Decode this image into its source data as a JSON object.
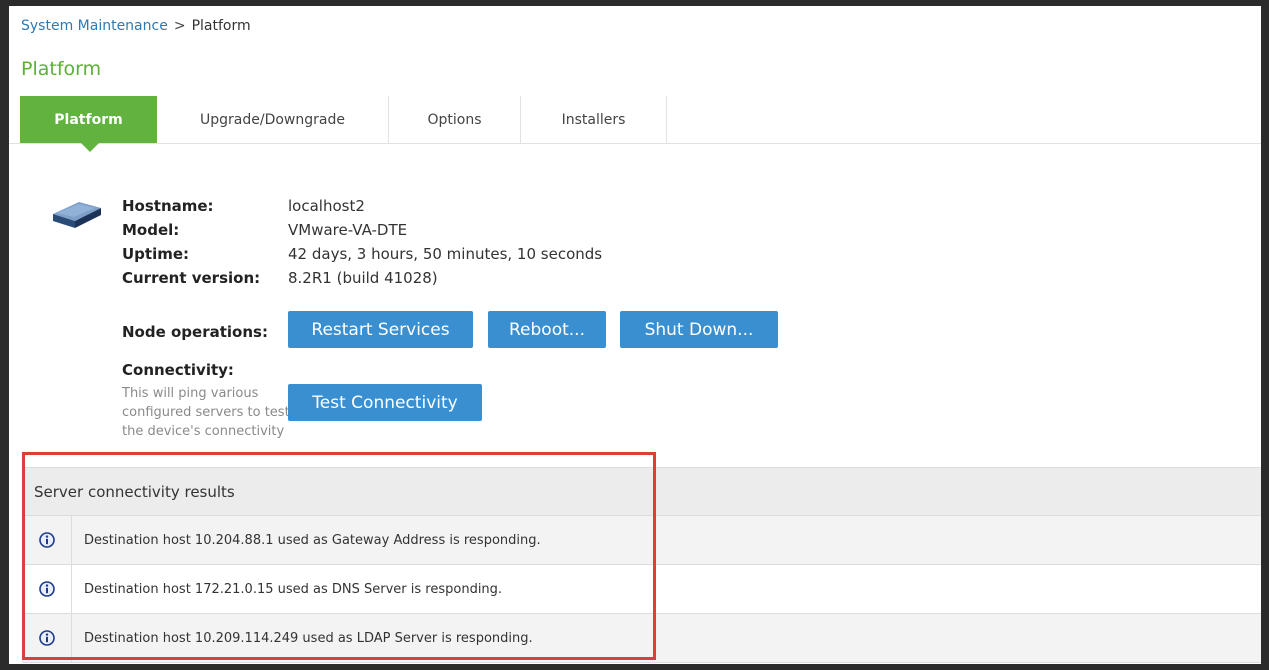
{
  "breadcrumb": {
    "parent": "System Maintenance",
    "separator": ">",
    "current": "Platform"
  },
  "page_title": "Platform",
  "tabs": [
    {
      "label": "Platform",
      "active": true
    },
    {
      "label": "Upgrade/Downgrade",
      "active": false
    },
    {
      "label": "Options",
      "active": false
    },
    {
      "label": "Installers",
      "active": false
    }
  ],
  "device": {
    "icon": "device-icon",
    "hostname_label": "Hostname:",
    "hostname": "localhost2",
    "model_label": "Model:",
    "model": "VMware-VA-DTE",
    "uptime_label": "Uptime:",
    "uptime": "42 days, 3 hours, 50 minutes, 10 seconds",
    "version_label": "Current version:",
    "version": "8.2R1 (build 41028)"
  },
  "node_ops": {
    "label": "Node operations:",
    "restart": "Restart Services",
    "reboot": "Reboot...",
    "shutdown": "Shut Down..."
  },
  "connectivity": {
    "label": "Connectivity:",
    "description": "This will ping various configured servers to test the device's connectivity",
    "button": "Test Connectivity"
  },
  "results": {
    "header": "Server connectivity results",
    "rows": [
      {
        "icon": "info-icon",
        "text": "Destination host 10.204.88.1 used as Gateway Address is responding."
      },
      {
        "icon": "info-icon",
        "text": "Destination host 172.21.0.15 used as DNS Server is responding."
      },
      {
        "icon": "info-icon",
        "text": "Destination host 10.209.114.249 used as LDAP Server is responding."
      }
    ]
  },
  "colors": {
    "accent_green": "#62b23f",
    "button_blue": "#3a8fd1",
    "highlight_red": "#d9403a",
    "link_blue": "#2a7ab8"
  }
}
